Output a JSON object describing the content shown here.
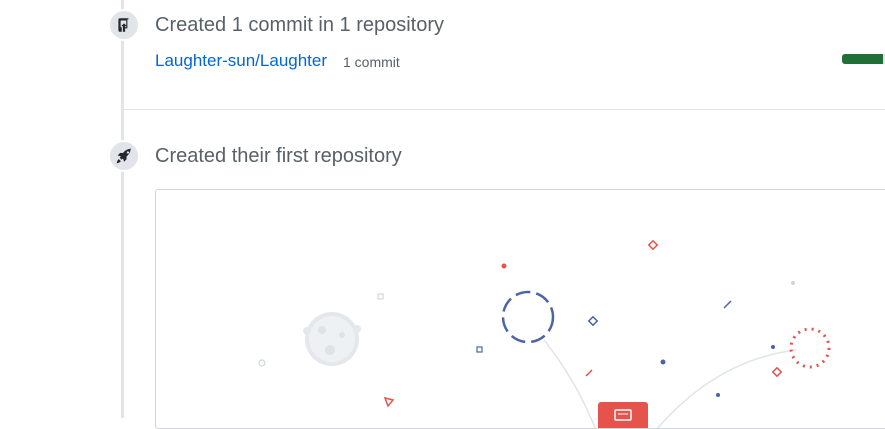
{
  "events": [
    {
      "icon": "repo-push-icon",
      "title": "Created 1 commit in 1 repository",
      "repository": {
        "name": "Laughter-sun/Laughter",
        "commit_count": "1 commit",
        "progress": 0.95
      }
    },
    {
      "icon": "rocket-icon",
      "title": "Created their first repository"
    }
  ],
  "colors": {
    "link": "#0366d6",
    "progress": "#216e39",
    "timeline": "#e1e4e8",
    "accent_red": "#e5534b",
    "accent_blue": "#4a64a6"
  },
  "illustration": {
    "description_icons": [
      "moon-icon",
      "satellite-icon",
      "planet-dots-icon",
      "repo-window-icon"
    ]
  }
}
